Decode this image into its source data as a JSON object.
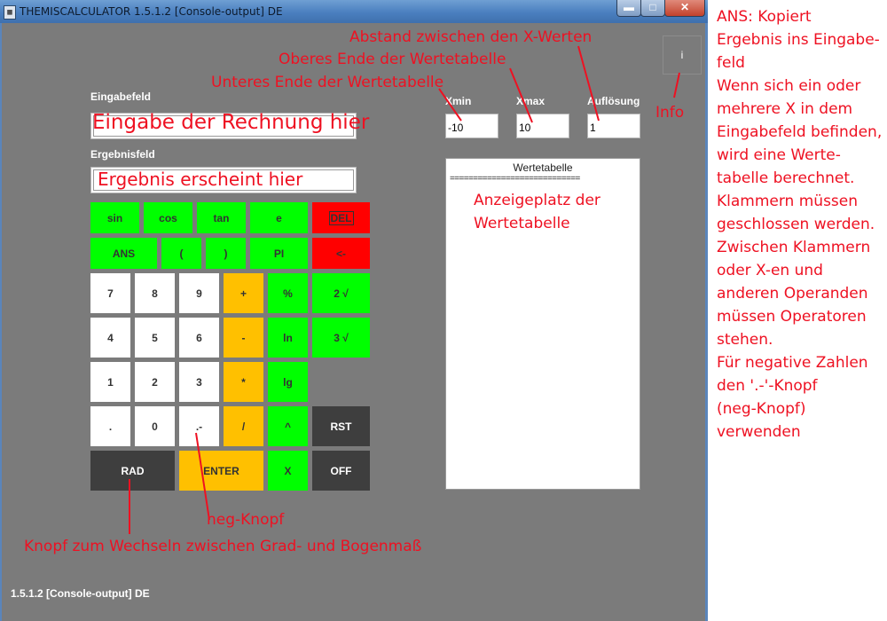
{
  "window": {
    "title": "THEMISCALCULATOR 1.5.1.2 [Console-output] DE",
    "min_glyph": "▬",
    "max_glyph": "□",
    "close_glyph": "✕",
    "app_icon_glyph": "▦"
  },
  "labels": {
    "input": "Eingabefeld",
    "result": "Ergebnisfeld",
    "xmin": "Xmin",
    "xmax": "Xmax",
    "resolution": "Auflösung"
  },
  "fields": {
    "xmin": "-10",
    "xmax": "10",
    "resolution": "1"
  },
  "buttons": {
    "sin": "sin",
    "cos": "cos",
    "tan": "tan",
    "e": "e",
    "del": "DEL",
    "ans": "ANS",
    "lparen": "(",
    "rparen": ")",
    "pi": "PI",
    "back": "<-",
    "n7": "7",
    "n8": "8",
    "n9": "9",
    "plus": "+",
    "percent": "%",
    "sqrt2": "2 √",
    "n4": "4",
    "n5": "5",
    "n6": "6",
    "minus": "-",
    "ln": "ln",
    "sqrt3": "3 √",
    "n1": "1",
    "n2": "2",
    "n3": "3",
    "times": "*",
    "lg": "lg",
    "dot": ".",
    "n0": "0",
    "neg": ".-",
    "div": "/",
    "pow": "^",
    "rst": "RST",
    "rad": "RAD",
    "enter": "ENTER",
    "x": "X",
    "off": "OFF"
  },
  "table": {
    "header": "Wertetabelle",
    "separator": "============================"
  },
  "info_button": "i",
  "status": "1.5.1.2 [Console-output] DE",
  "annotations": {
    "input_hint": "Eingabe der Rechnung hier",
    "result_hint": "Ergebnis erscheint hier",
    "step": "Abstand zwischen den X-Werten",
    "upper": "Oberes Ende der Wertetabelle",
    "lower": "Unteres Ende der Wertetabelle",
    "info": "Info",
    "table_place_1": "Anzeigeplatz der",
    "table_place_2": "Wertetabelle",
    "neg_button": "neg-Knopf",
    "rad_button": "Knopf zum Wechseln zwischen Grad- und Bogenmaß"
  },
  "notes": [
    "ANS: Kopiert",
    "Ergebnis ins Eingabe-",
    "feld",
    "Wenn sich ein oder",
    "mehrere X in dem",
    "Eingabefeld befinden,",
    "wird eine Werte-",
    "tabelle berechnet.",
    "Klammern müssen",
    "geschlossen werden.",
    "Zwischen Klammern",
    "oder X-en und",
    "anderen Operanden",
    "müssen Operatoren",
    "stehen.",
    "Für negative Zahlen",
    "den '.-'-Knopf",
    "(neg-Knopf)",
    "verwenden"
  ],
  "colors": {
    "window_bg": "#7b7b7b",
    "function_green": "#00ff00",
    "delete_red": "#ff0000",
    "operator_orange": "#ffc000",
    "dark_button": "#3e3e3e",
    "annotation_red": "#ee1122"
  }
}
